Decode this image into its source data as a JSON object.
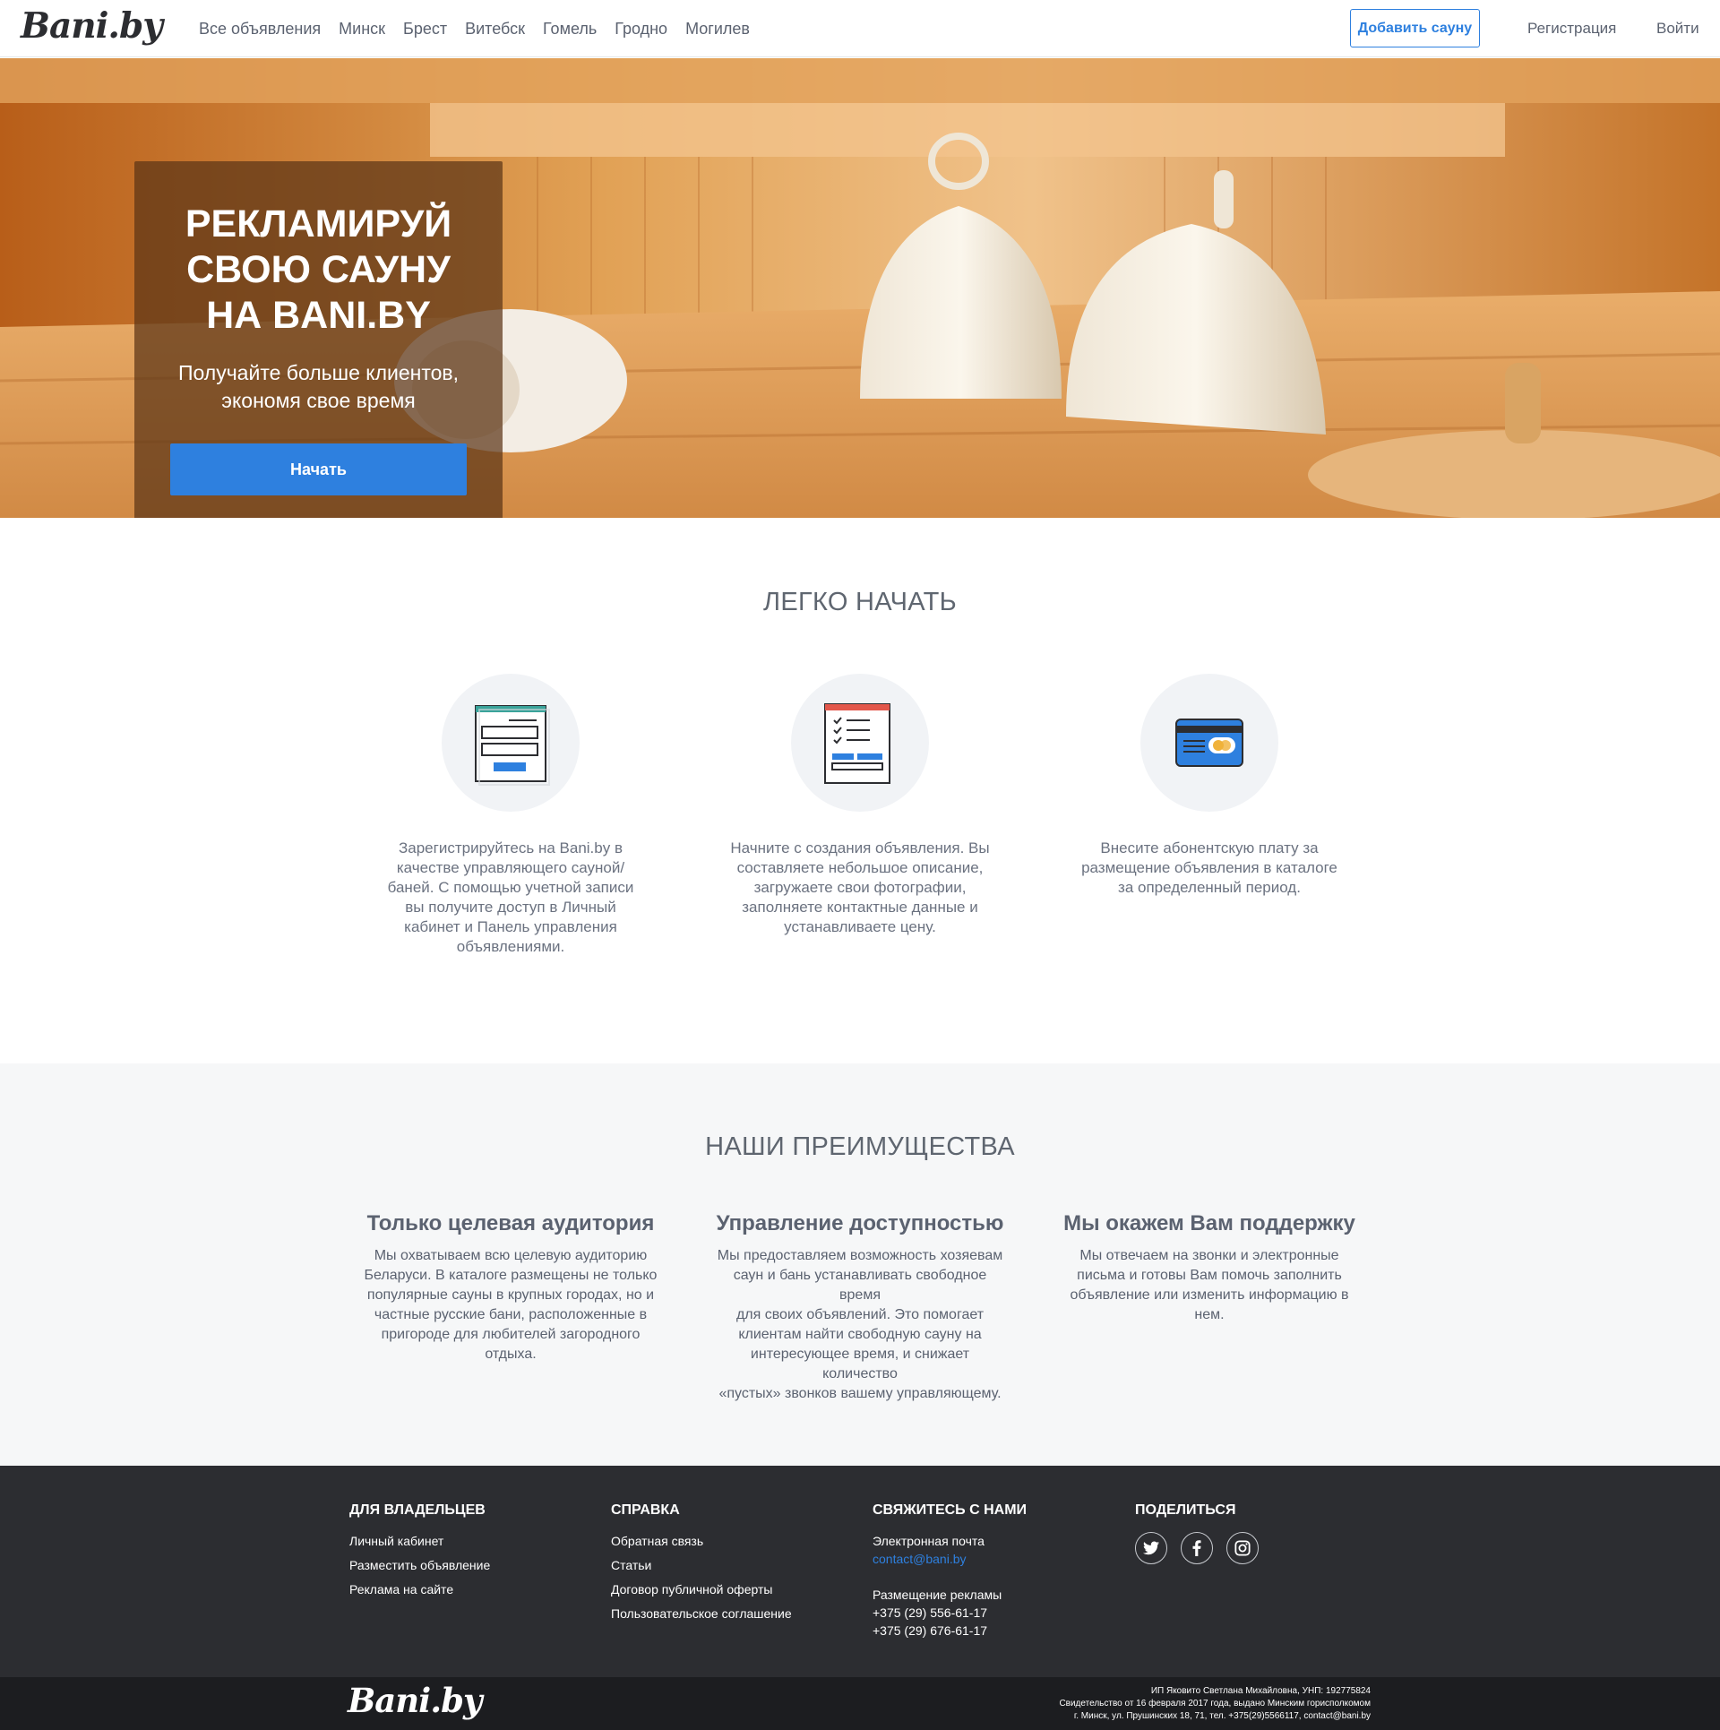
{
  "nav": {
    "logo": "Bani.by",
    "links": [
      "Все объявления",
      "Минск",
      "Брест",
      "Витебск",
      "Гомель",
      "Гродно",
      "Могилев"
    ],
    "add_sauna": "Добавить сауну",
    "register": "Регистрация",
    "login": "Войти"
  },
  "hero": {
    "title_lines": [
      "РЕКЛАМИРУЙ",
      "СВОЮ САУНУ",
      "НА BANI.BY"
    ],
    "subtitle_lines": [
      "Получайте больше клиентов,",
      "экономя свое время"
    ],
    "start_button": "Начать"
  },
  "easy_start": {
    "title": "ЛЕГКО НАЧАТЬ",
    "steps": [
      {
        "icon": "registration-form-icon",
        "text_lines": [
          "Зарегистрируйтесь на Bani.by в",
          "качестве управляющего сауной/",
          "баней. С помощью учетной записи",
          "вы получите доступ в Личный",
          "кабинет и Панель управления",
          "объявлениями."
        ]
      },
      {
        "icon": "checklist-document-icon",
        "text_lines": [
          "Начните с создания объявления. Вы",
          "составляете небольшое описание,",
          "загружаете свои фотографии,",
          "заполняете контактные данные и",
          "устанавливаете цену."
        ]
      },
      {
        "icon": "credit-card-icon",
        "text_lines": [
          "Внесите абонентскую плату за",
          "размещение объявления в каталоге",
          "за определенный период."
        ]
      }
    ]
  },
  "advantages": {
    "title": "НАШИ ПРЕИМУЩЕСТВА",
    "items": [
      {
        "heading": "Только целевая аудитория",
        "text_lines": [
          "Мы охватываем всю целевую аудиторию",
          "Беларуси. В каталоге размещены не только",
          "популярные сауны в крупных городах, но и",
          "частные русские бани, расположенные в",
          "пригороде для любителей загородного",
          "отдыха."
        ]
      },
      {
        "heading": "Управление доступностью",
        "text_lines": [
          "Мы предоставляем возможность хозяевам",
          "саун и бань устанавливать свободное время",
          "для своих объявлений. Это помогает",
          "клиентам найти свободную сауну на",
          "интересующее время, и снижает количество",
          "«пустых» звонков вашему управляющему."
        ]
      },
      {
        "heading": "Мы окажем Вам поддержку",
        "text_lines": [
          "Мы отвечаем на звонки и электронные",
          "письма и готовы Вам помочь заполнить",
          "объявление или изменить информацию в",
          "нем."
        ]
      }
    ]
  },
  "footer": {
    "owners": {
      "title": "ДЛЯ ВЛАДЕЛЬЦЕВ",
      "links": [
        "Личный кабинет",
        "Разместить объявление",
        "Реклама на сайте"
      ]
    },
    "help": {
      "title": "СПРАВКА",
      "links": [
        "Обратная связь",
        "Статьи",
        "Договор публичной оферты",
        "Пользовательское соглашение"
      ]
    },
    "contact": {
      "title": "СВЯЖИТЕСЬ С НАМИ",
      "email_label": "Электронная почта",
      "email": "contact@bani.by",
      "ads_label": "Размещение рекламы",
      "phones": [
        "+375 (29) 556-61-17",
        "+375 (29) 676-61-17"
      ]
    },
    "share": {
      "title": "ПОДЕЛИТЬСЯ",
      "icons": [
        "twitter-icon",
        "facebook-icon",
        "instagram-icon"
      ]
    },
    "logo": "Bani.by",
    "legal_lines": [
      "ИП Яковито Светлана Михайловна, УНП: 192775824",
      "Свидетельство от 16 февраля 2017 года, выдано Минским горисполкомом",
      "г. Минск, ул. Прушинских 18, 71, тел. +375(29)5566117, contact@bani.by"
    ]
  },
  "colors": {
    "accent": "#2e80df",
    "footer_bg": "#2c2d31",
    "footer_bottom_bg": "#1c1d20",
    "section_bg": "#f6f7f8"
  }
}
